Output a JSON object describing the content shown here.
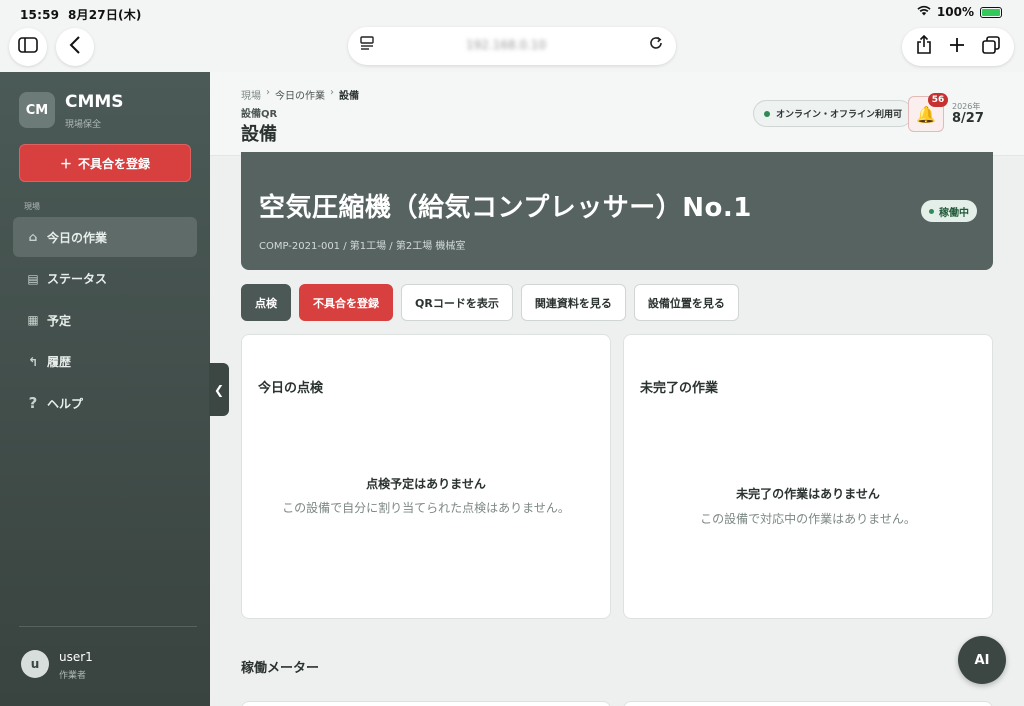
{
  "device": {
    "time": "15:59",
    "date": "8月27日(木)",
    "battery": "100%",
    "battery_level": 1.0
  },
  "browser": {
    "url": "192.168.0.10",
    "icons": {
      "sidebar": "sidebar-icon",
      "back": "back-icon",
      "page_menu": "page-menu-icon",
      "reload": "reload-icon",
      "share": "share-icon",
      "new_tab": "plus-icon",
      "tabs": "tabs-icon"
    }
  },
  "sidebar": {
    "logo": "CM",
    "app_name": "CMMS",
    "app_sub": "現場保全",
    "report_button": "不具合を登録",
    "section_label": "現場",
    "items": [
      {
        "label": "今日の作業",
        "icon": "home-icon",
        "active": true
      },
      {
        "label": "ステータス",
        "icon": "status-icon",
        "active": false
      },
      {
        "label": "予定",
        "icon": "calendar-icon",
        "active": false
      },
      {
        "label": "履歴",
        "icon": "history-icon",
        "active": false
      },
      {
        "label": "ヘルプ",
        "icon": "help-icon",
        "active": false
      }
    ],
    "user": {
      "initial": "u",
      "name": "user1",
      "role": "作業者"
    }
  },
  "header": {
    "breadcrumbs": [
      "現場",
      "今日の作業",
      "設備"
    ],
    "subtitle": "設備QR",
    "title": "設備",
    "online_status": "オンライン・オフライン利用可",
    "notification_count": "56",
    "year": "2026年",
    "date": "8/27"
  },
  "equipment": {
    "name": "空気圧縮機（給気コンプレッサー）No.1",
    "meta": "COMP-2021-001 / 第1工場 / 第2工場 機械室",
    "status": "稼働中"
  },
  "actions": [
    "点検",
    "不具合を登録",
    "QRコードを表示",
    "関連資料を見る",
    "設備位置を見る"
  ],
  "cards": {
    "inspection": {
      "title": "今日の点検",
      "empty_title": "点検予定はありません",
      "empty_desc": "この設備で自分に割り当てられた点検はありません。"
    },
    "tasks": {
      "title": "未完了の作業",
      "empty_title": "未完了の作業はありません",
      "empty_desc": "この設備で対応中の作業はありません。"
    }
  },
  "meters_section": "稼働メーター",
  "ai_button": "AI",
  "colors": {
    "sidebar": "#45524f",
    "accent_red": "#d84040",
    "banner": "#566361",
    "online_green": "#2f8a55"
  }
}
